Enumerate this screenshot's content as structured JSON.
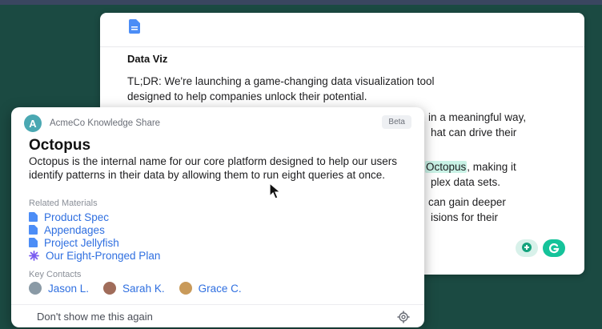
{
  "document": {
    "icon": "doc-icon",
    "title": "Data Viz",
    "paragraph1_line1": "TL;DR: We're launching a game-changing data visualization tool",
    "paragraph1_line2": "designed to help companies unlock their potential.",
    "p2_line1": "in a meaningful way,",
    "p2_line2": "hat can drive their",
    "p3_highlight": "Octopus",
    "p3_line1_rest": ", making it",
    "p3_line2": "plex data sets.",
    "p4_line1": "can gain deeper",
    "p4_line2": "isions for their"
  },
  "popup": {
    "app_name": "AcmeCo Knowledge Share",
    "logo_letter": "A",
    "beta_label": "Beta",
    "title": "Octopus",
    "description": "Octopus is the internal name for our core platform designed to help our users identify patterns in their data by allowing them to run eight queries at once.",
    "related_label": "Related Materials",
    "materials": [
      {
        "label": "Product Spec",
        "icon": "file-icon"
      },
      {
        "label": "Appendages",
        "icon": "file-icon"
      },
      {
        "label": "Project Jellyfish",
        "icon": "file-icon"
      },
      {
        "label": "Our Eight-Pronged Plan",
        "icon": "sparkle-icon"
      }
    ],
    "contacts_label": "Key Contacts",
    "contacts": [
      {
        "name": "Jason L."
      },
      {
        "name": "Sarah K."
      },
      {
        "name": "Grace C."
      }
    ],
    "dont_show": "Don't show me this again"
  },
  "colors": {
    "background": "#1b4a42",
    "link": "#2f6fe0",
    "highlight": "#c9f2e6",
    "brand_green": "#15c39a"
  }
}
